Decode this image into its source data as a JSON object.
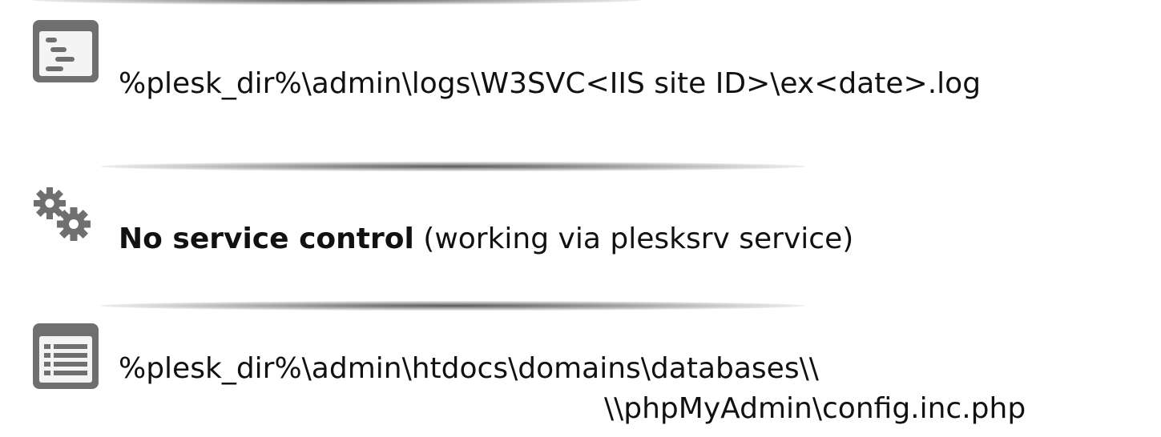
{
  "rows": [
    {
      "icon": "log-file-icon",
      "text": "%plesk_dir%\\admin\\logs\\W3SVC<IIS site ID>\\ex<date>.log"
    },
    {
      "icon": "gears-icon",
      "bold": "No service control",
      "rest": " (working via plesksrv service)"
    },
    {
      "icon": "config-file-icon",
      "line1": "%plesk_dir%\\admin\\htdocs\\domains\\databases\\\\",
      "line2": "\\\\phpMyAdmin\\config.inc.php"
    }
  ],
  "colors": {
    "icon_gray": "#6f6f6f",
    "text": "#111111",
    "background": "#ffffff"
  }
}
